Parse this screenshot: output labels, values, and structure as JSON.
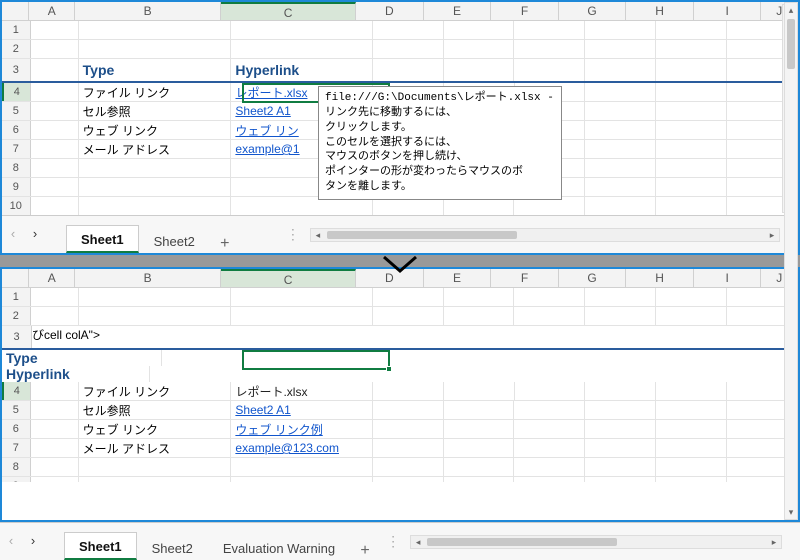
{
  "columns": [
    "A",
    "B",
    "C",
    "D",
    "E",
    "F",
    "G",
    "H",
    "I",
    "J"
  ],
  "header": {
    "b": "Type",
    "c": "Hyperlink"
  },
  "rows_top": [
    {
      "b": "ファイル リンク",
      "c": "レポート.xlsx",
      "is_link": true
    },
    {
      "b": "セル参照",
      "c": "Sheet2 A1",
      "is_link": true
    },
    {
      "b": "ウェブ リンク",
      "c": "ウェブ リン",
      "is_link": true
    },
    {
      "b": "メール アドレス",
      "c": "example@1",
      "is_link": true
    }
  ],
  "rows_bot": [
    {
      "b": "ファイル リンク",
      "c": "レポート.xlsx",
      "is_link": false
    },
    {
      "b": "セル参照",
      "c": "Sheet2 A1",
      "is_link": true
    },
    {
      "b": "ウェブ リンク",
      "c": "ウェブ リンク例",
      "is_link": true
    },
    {
      "b": "メール アドレス",
      "c": "example@123.com",
      "is_link": true
    }
  ],
  "tooltip": "file:///G:\\Documents\\レポート.xlsx -\nリンク先に移動するには、\nクリックします。\nこのセルを選択するには、\nマウスのボタンを押し続け、\nポインターの形が変わったらマウスのボ\nタンを離します。",
  "tabs_top": {
    "sheet1": "Sheet1",
    "sheet2": "Sheet2",
    "add": "+",
    "grip": "⋮"
  },
  "tabs_bot": {
    "sheet1": "Sheet1",
    "sheet2": "Sheet2",
    "warn": "Evaluation Warning",
    "add": "+",
    "grip": "⋮"
  },
  "selected_cell": "C4",
  "nav": {
    "prev": "‹",
    "next": "›"
  },
  "scroll": {
    "up": "▴",
    "down": "▾",
    "left": "◂",
    "right": "▸"
  }
}
